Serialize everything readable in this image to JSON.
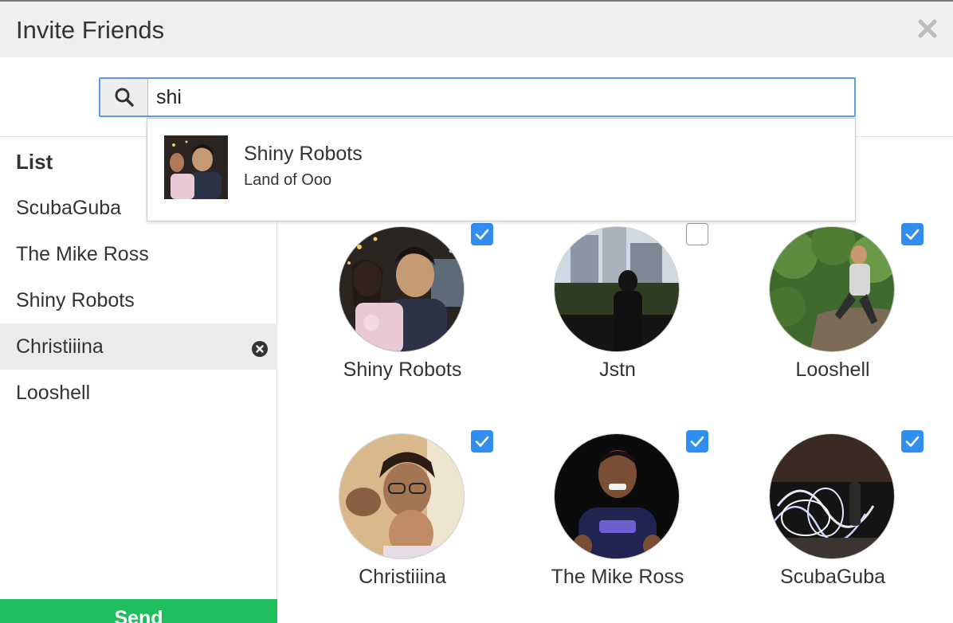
{
  "dialog": {
    "title": "Invite Friends",
    "close_icon": "close-icon"
  },
  "search": {
    "icon": "search-icon",
    "value": "shi"
  },
  "suggestion": {
    "name": "Shiny Robots",
    "subtitle": "Land of Ooo"
  },
  "sidebar": {
    "heading": "List",
    "items": [
      {
        "label": "ScubaGuba",
        "selected": false
      },
      {
        "label": "The Mike Ross",
        "selected": false
      },
      {
        "label": "Shiny Robots",
        "selected": false
      },
      {
        "label": "Christiiina",
        "selected": true
      },
      {
        "label": "Looshell",
        "selected": false
      }
    ],
    "send_label": "Send"
  },
  "friends": [
    {
      "name": "Shiny Robots",
      "checked": true
    },
    {
      "name": "Jstn",
      "checked": false
    },
    {
      "name": "Looshell",
      "checked": true
    },
    {
      "name": "Christiiina",
      "checked": true
    },
    {
      "name": "The Mike Ross",
      "checked": true
    },
    {
      "name": "ScubaGuba",
      "checked": true
    }
  ],
  "colors": {
    "accent": "#2f8ef0",
    "send": "#1ebe5d",
    "focus": "#5b9be6"
  }
}
